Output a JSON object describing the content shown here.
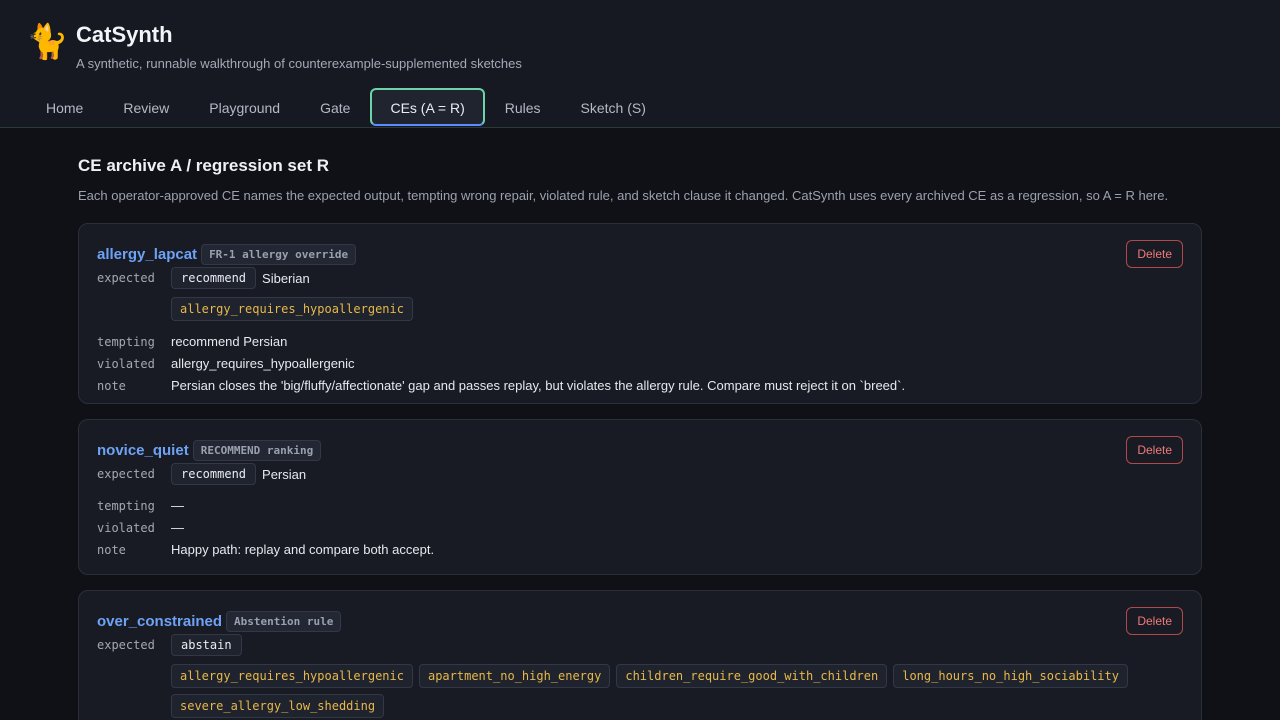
{
  "app": {
    "logo": "🐈",
    "title": "CatSynth",
    "subtitle": "A synthetic, runnable walkthrough of counterexample-supplemented sketches"
  },
  "tabs": [
    {
      "label": "Home"
    },
    {
      "label": "Review"
    },
    {
      "label": "Playground"
    },
    {
      "label": "Gate"
    },
    {
      "label": "CEs (A = R)"
    },
    {
      "label": "Rules"
    },
    {
      "label": "Sketch (S)"
    }
  ],
  "active_tab": "CEs (A = R)",
  "section": {
    "title": "CE archive A / regression set R",
    "description": "Each operator-approved CE names the expected output, tempting wrong repair, violated rule, and sketch clause it changed. CatSynth uses every archived CE as a regression, so A = R here."
  },
  "labels": {
    "expected": "expected",
    "tempting": "tempting",
    "violated": "violated",
    "note": "note",
    "delete": "Delete"
  },
  "ces": [
    {
      "name": "allergy_lapcat",
      "kind": "FR-1 allergy override",
      "expected_verb": "recommend",
      "expected_value": "Siberian",
      "rules": [
        "allergy_requires_hypoallergenic"
      ],
      "tempting": "recommend Persian",
      "violated": "allergy_requires_hypoallergenic",
      "note": "Persian closes the 'big/fluffy/affectionate' gap and passes replay, but violates the allergy rule. Compare must reject it on `breed`."
    },
    {
      "name": "novice_quiet",
      "kind": "RECOMMEND ranking",
      "expected_verb": "recommend",
      "expected_value": "Persian",
      "rules": [],
      "tempting": "—",
      "violated": "—",
      "note": "Happy path: replay and compare both accept."
    },
    {
      "name": "over_constrained",
      "kind": "Abstention rule",
      "expected_verb": "abstain",
      "expected_value": "",
      "rules": [
        "allergy_requires_hypoallergenic",
        "apartment_no_high_energy",
        "children_require_good_with_children",
        "long_hours_no_high_sociability",
        "severe_allergy_low_shedding"
      ],
      "tempting": "",
      "violated": "",
      "note": ""
    }
  ]
}
